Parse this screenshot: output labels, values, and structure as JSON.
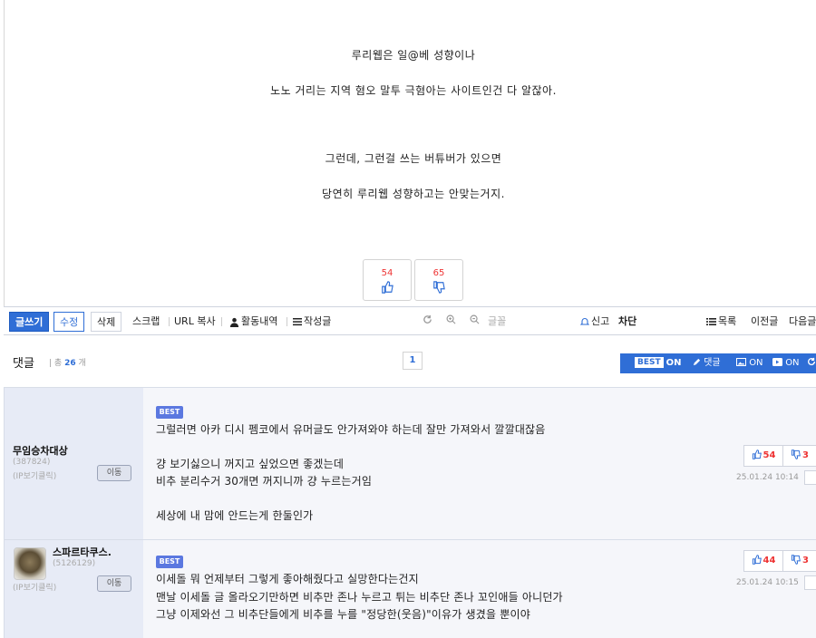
{
  "article": {
    "lines": [
      "루리웹은 일@베 성향이나",
      "노노 거리는 지역 혐오 말투 극혐아는 사이트인건 다 알잖아.",
      "그런데, 그런걸 쓰는 버튜버가 있으면",
      "당연히 루리웹 성향하고는 안맞는거지."
    ],
    "upvotes": "54",
    "downvotes": "65"
  },
  "toolbar": {
    "write": "글쓰기",
    "edit": "수정",
    "delete": "삭제",
    "scrap": "스크랩",
    "url_copy": "URL 복사",
    "activity": "활동내역",
    "posts": "작성글",
    "font": "글꼴",
    "report": "신고",
    "block": "차단",
    "list": "목록",
    "prev": "이전글",
    "next": "다음글"
  },
  "comments_header": {
    "title": "댓글",
    "total_label": "총",
    "total": "26",
    "unit": "개",
    "page": "1",
    "best_label": "BEST",
    "best_state": "ON",
    "reply": "댓글",
    "image_state": "ON",
    "video_state": "ON"
  },
  "comments": [
    {
      "nick": "무임승차대상",
      "uid": "(387824)",
      "ip": "(IP보기클릭)",
      "move": "이동",
      "badge": "BEST",
      "lines": [
        "그럴러면 아카 디시 펨코에서 유머글도 안가져와야 하는데 잘만 가져와서 깔깔대잖음",
        "걍 보기싫으니 꺼지고 싶었으면 좋겠는데",
        "비추 분리수거 30개면 꺼지니까 걍 누르는거임",
        "세상에 내 맘에 안드는게 한둘인가"
      ],
      "up": "54",
      "down": "3",
      "date": "25.01.24",
      "time": "10:14"
    },
    {
      "nick": "스파르타쿠스.",
      "uid": "(5126129)",
      "ip": "(IP보기클릭)",
      "move": "이동",
      "badge": "BEST",
      "lines": [
        "이세돌 뭐 언제부터 그렇게 좋아해줬다고 실망한다는건지",
        "맨날 이세돌 글 올라오기만하면 비추만 존나 누르고 튀는 비추단 존나 꼬인애들 아니던가",
        "그냥 이제와선 그 비추단들에게 비추를 누를 \"정당한(웃음)\"이유가 생겼을 뿐이야"
      ],
      "up": "44",
      "down": "3",
      "date": "25.01.24",
      "time": "10:15"
    }
  ]
}
